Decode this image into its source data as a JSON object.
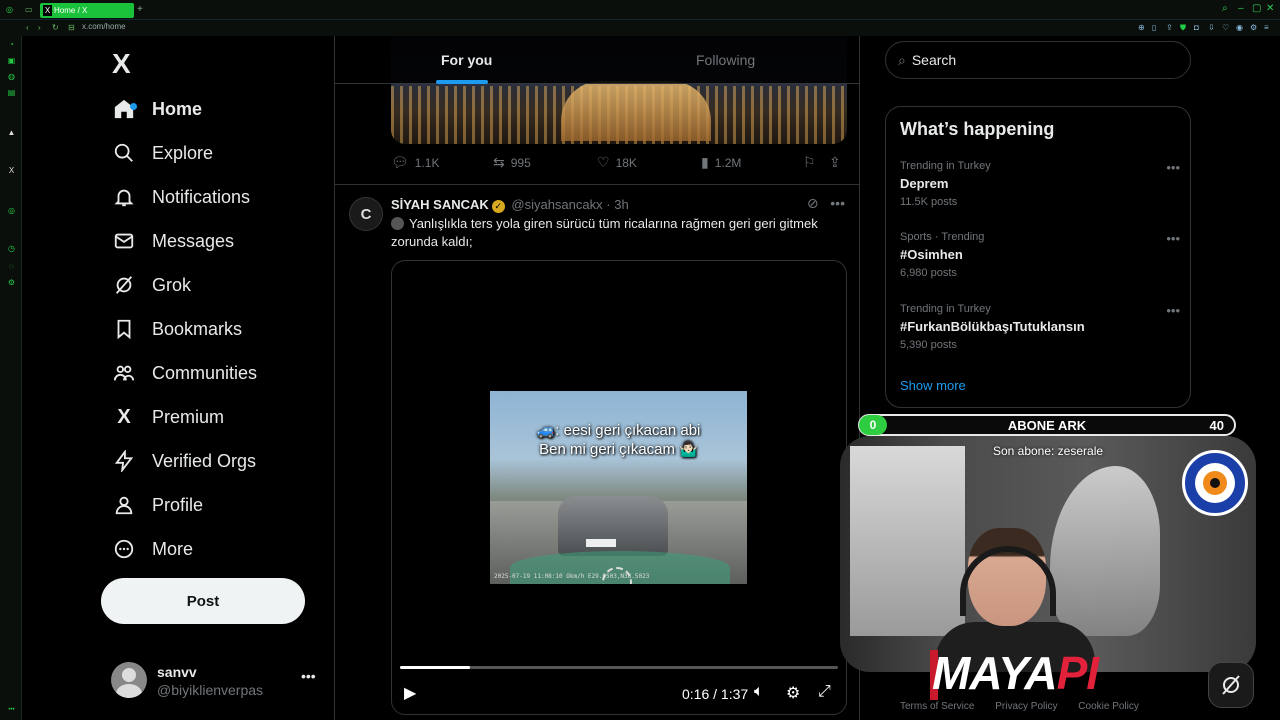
{
  "browser": {
    "tab_title": "Home / X",
    "url": "x.com/home"
  },
  "sidebar": {
    "logo": "X",
    "items": [
      {
        "label": "Home",
        "icon": "home-icon"
      },
      {
        "label": "Explore",
        "icon": "search-icon"
      },
      {
        "label": "Notifications",
        "icon": "bell-icon"
      },
      {
        "label": "Messages",
        "icon": "envelope-icon"
      },
      {
        "label": "Grok",
        "icon": "grok-icon"
      },
      {
        "label": "Bookmarks",
        "icon": "bookmark-icon"
      },
      {
        "label": "Communities",
        "icon": "people-icon"
      },
      {
        "label": "Premium",
        "icon": "x-icon"
      },
      {
        "label": "Verified Orgs",
        "icon": "lightning-icon"
      },
      {
        "label": "Profile",
        "icon": "person-icon"
      },
      {
        "label": "More",
        "icon": "more-circle-icon"
      }
    ],
    "post_label": "Post",
    "account": {
      "name": "sanvv",
      "handle": "@biyiklienverpas"
    }
  },
  "main": {
    "tabs": [
      {
        "label": "For you"
      },
      {
        "label": "Following"
      }
    ],
    "prev_tweet_actions": {
      "replies": "1.1K",
      "reposts": "995",
      "likes": "18K",
      "views": "1.2M"
    },
    "tweet": {
      "avatar_letter": "C",
      "name": "SİYAH SANCAK",
      "handle": "@siyahsancakx",
      "time": "3h",
      "text": "Yanlışlıkla ters yola giren sürücü tüm ricalarına rağmen geri geri gitmek zorunda kaldı;",
      "video": {
        "caption_line1": "🚙: eesi geri çıkacan abi",
        "caption_line2": "Ben mi geri çıkacam 🤷🏻‍♂️",
        "stamp": "2025-07-19 11:08:10        Okm/h E29.0503,N38.5023",
        "time": "0:16 / 1:37",
        "progress": 0.16
      }
    }
  },
  "right": {
    "search_placeholder": "Search",
    "happening_title": "What’s happening",
    "trends": [
      {
        "context": "Trending in Turkey",
        "topic": "Deprem",
        "count": "11.5K posts"
      },
      {
        "context": "Sports · Trending",
        "topic": "#Osimhen",
        "count": "6,980 posts"
      },
      {
        "context": "Trending in Turkey",
        "topic": "#FurkanBölükbaşıTutuklansın",
        "count": "5,390 posts"
      }
    ],
    "show_more": "Show more",
    "footer": [
      "Terms of Service",
      "Privacy Policy",
      "Cookie Policy"
    ]
  },
  "overlay": {
    "sub_current": "0",
    "sub_title": "ABONE ARK",
    "sub_goal": "40",
    "last_sub": "Son abone: zeserale",
    "logo_main": "MAYA",
    "logo_accent": "PI"
  },
  "colors": {
    "accent": "#1d9bf0",
    "browser_green": "#19c23a",
    "sub_green": "#2ecc40",
    "logo_red": "#e2213b"
  }
}
